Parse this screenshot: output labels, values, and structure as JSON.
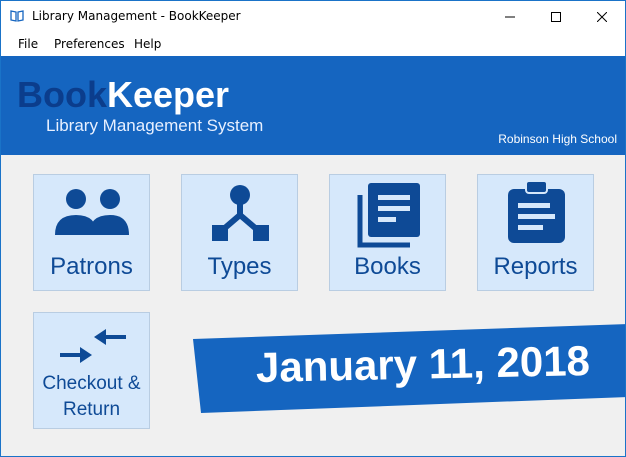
{
  "window": {
    "title": "Library Management - BookKeeper",
    "icon": "book-icon"
  },
  "menu": {
    "items": [
      "File",
      "Preferences",
      "Help"
    ]
  },
  "header": {
    "logo_part1": "Book",
    "logo_part2": "Keeper",
    "subtitle": "Library Management System",
    "school": "Robinson High School",
    "color": "#1565c0"
  },
  "tiles": [
    {
      "label": "Patrons",
      "icon": "people-icon"
    },
    {
      "label": "Types",
      "icon": "hierarchy-icon"
    },
    {
      "label": "Books",
      "icon": "books-icon"
    },
    {
      "label": "Reports",
      "icon": "clipboard-icon"
    },
    {
      "label_line1": "Checkout &",
      "label_line2": "Return",
      "icon": "exchange-arrows-icon"
    }
  ],
  "date": "January 11, 2018",
  "colors": {
    "accent": "#1565c0",
    "tile_bg": "#d6e8fb",
    "icon": "#0e4a96"
  }
}
